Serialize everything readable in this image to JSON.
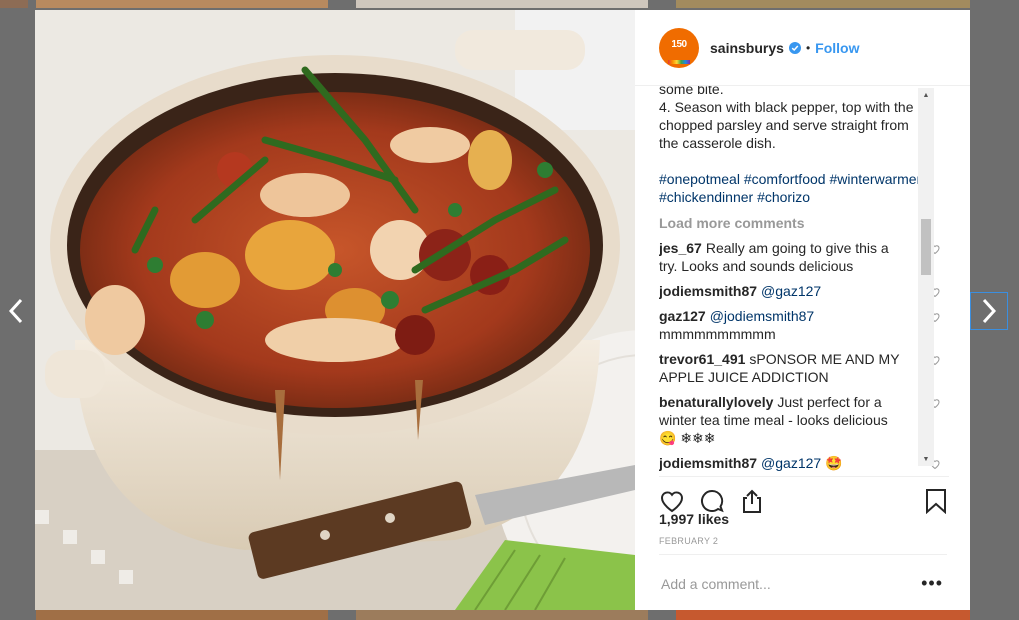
{
  "post": {
    "username": "sainsburys",
    "avatar_text": "150",
    "follow_label": "Follow",
    "caption_lines": [
      "some bite.",
      "4. Season with black pepper, top with the",
      "chopped parsley and serve straight from",
      "the casserole dish."
    ],
    "hashtags": [
      "#onepotmeal",
      "#comfortfood",
      "#winterwarmer",
      "#chickendinner",
      "#chorizo"
    ],
    "load_more_label": "Load more comments",
    "comments": [
      {
        "user": "jes_67",
        "text": "Really am going to give this a try. Looks and sounds delicious",
        "mention": ""
      },
      {
        "user": "jodiemsmith87",
        "text": "",
        "mention": "@gaz127"
      },
      {
        "user": "gaz127",
        "text": "mmmmmmmmmm",
        "mention": "@jodiemsmith87"
      },
      {
        "user": "trevor61_491",
        "text": "sPONSOR ME AND MY APPLE JUICE ADDICTION",
        "mention": ""
      },
      {
        "user": "benaturallylovely",
        "text": "Just perfect for a winter tea time meal - looks delicious 😋 ❄❄❄",
        "mention": ""
      },
      {
        "user": "jodiemsmith87",
        "text": "🤩",
        "mention": "@gaz127"
      }
    ],
    "likes": "1,997 likes",
    "date": "FEBRUARY 2",
    "comment_placeholder": "Add a comment...",
    "more_label": "•••"
  },
  "icons": {
    "prev": "chevron-left-icon",
    "next": "chevron-right-icon",
    "like": "heart-icon",
    "comment": "comment-icon",
    "share": "share-icon",
    "save": "bookmark-icon",
    "verified": "verified-badge-icon"
  },
  "colors": {
    "link": "#3897f0",
    "hashtag": "#003569",
    "avatar_bg": "#f06c00",
    "overlay": "#6e6e6e"
  }
}
